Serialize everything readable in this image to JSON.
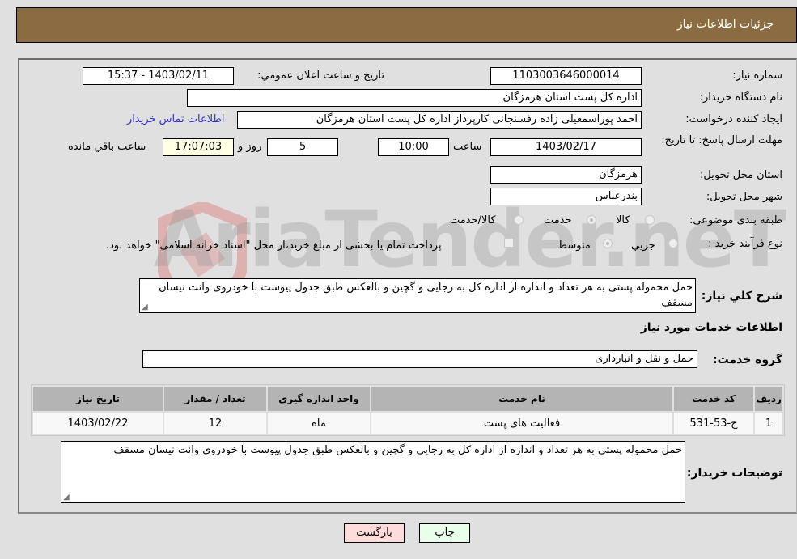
{
  "header": {
    "title": "جزئیات اطلاعات نیاز"
  },
  "fields": {
    "need_number": {
      "label": "شماره نیاز:",
      "value": "1103003646000014"
    },
    "announce_datetime": {
      "label": "تاریخ و ساعت اعلان عمومي:",
      "value": "1403/02/11 - 15:37"
    },
    "buyer_org": {
      "label": "نام دستگاه خريدار:",
      "value": "اداره کل پست استان هرمزگان"
    },
    "requester": {
      "label": "ایجاد کننده درخواست:",
      "value": "احمد پوراسمعیلی زاده رفسنجانی کارپرداز اداره کل پست استان هرمزگان"
    },
    "buyer_contact_link": "اطلاعات تماس خریدار",
    "deadline": {
      "label": "مهلت ارسال پاسخ: تا تاریخ:",
      "date": "1403/02/17",
      "time_label": "ساعت",
      "time": "10:00",
      "days": "5",
      "days_label": "روز و",
      "remaining": "17:07:03",
      "remaining_label": "ساعت باقي مانده"
    },
    "province": {
      "label": "استان محل تحویل:",
      "value": "هرمزگان"
    },
    "city": {
      "label": "شهر محل تحویل:",
      "value": "بندرعباس"
    },
    "category": {
      "label": "طبقه بندی موضوعی:",
      "options": [
        "کالا",
        "خدمت",
        "کالا/خدمت"
      ],
      "selected": "خدمت"
    },
    "purchase_type": {
      "label": "نوع فرآیند خرید :",
      "options": [
        "جزيي",
        "متوسط"
      ],
      "selected": "متوسط",
      "treasury_note": "پرداخت تمام یا بخشی از مبلغ خرید،از محل \"اسناد خزانه اسلامی\" خواهد بود.",
      "treasury_checked": false
    }
  },
  "description": {
    "label": "شرح کلي نياز:",
    "value": "حمل محموله پستی به هر تعداد و اندازه از اداره کل به رجایی و گچین و بالعکس طبق جدول پیوست با خودروی وانت نیسان مسقف"
  },
  "services_section": {
    "title": "اطلاعات خدمات مورد نياز",
    "group_label": "گروه خدمت:",
    "group_value": "حمل و نقل و انبارداری"
  },
  "table": {
    "headers": [
      "رديف",
      "کد خدمت",
      "نام خدمت",
      "واحد اندازه گیری",
      "تعداد / مقدار",
      "تاريخ نياز"
    ],
    "rows": [
      [
        "1",
        "ح-53-531",
        "فعالیت های پست",
        "ماه",
        "12",
        "1403/02/22"
      ]
    ]
  },
  "buyer_notes": {
    "label": "توضیحات خریدار:",
    "value": "حمل محموله پستی به هر تعداد و اندازه از اداره کل به رجایی و گچین و بالعکس طبق جدول پیوست با خودروی وانت نیسان مسقف"
  },
  "buttons": {
    "print": "چاپ",
    "back": "بازگشت"
  },
  "watermark": "AriaTender.neT",
  "colors": {
    "header_bg": "#8b6c42",
    "print_bg": "#eaffea",
    "back_bg": "#ffdcdc",
    "link": "#3333cc"
  }
}
